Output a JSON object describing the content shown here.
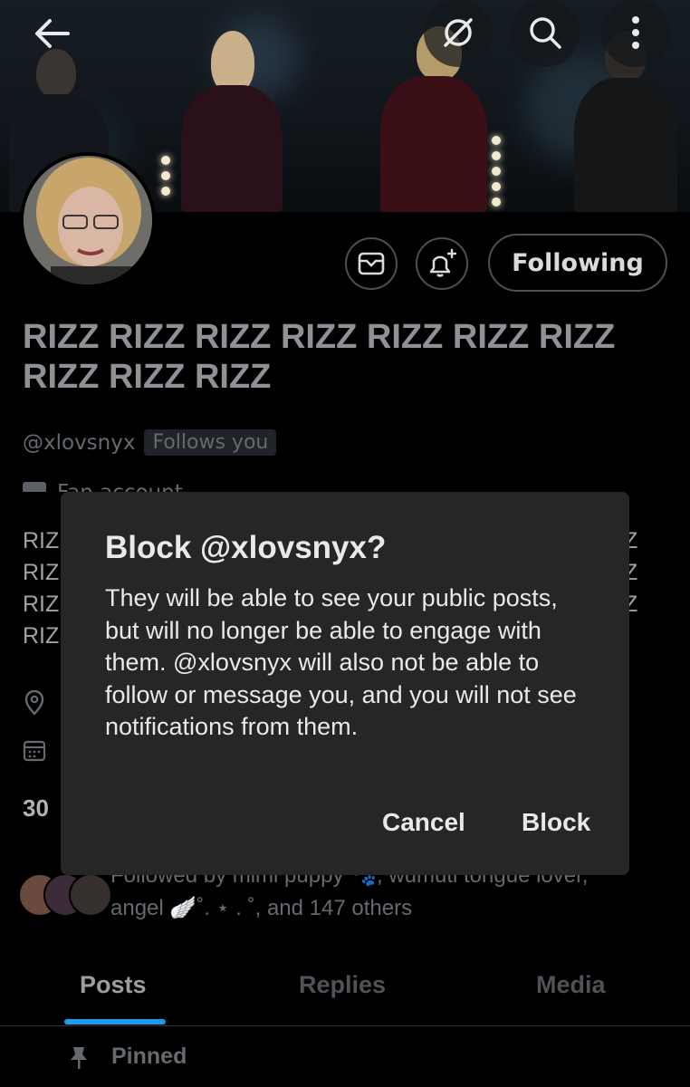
{
  "header": {
    "back_icon": "arrow-left-icon",
    "grok_icon": "slashed-circle-icon",
    "search_icon": "search-icon",
    "more_icon": "more-vertical-icon"
  },
  "profile": {
    "display_name": "RIZZ RIZZ RIZZ RIZZ RIZZ RIZZ RIZZ RIZZ RIZZ RIZZ",
    "handle": "@xlovsnyx",
    "follows_you_label": "Follows you",
    "category_label": "Fan account",
    "bio_left_lines": [
      "RIZ",
      "RIZ",
      "RIZ",
      "RIZ"
    ],
    "bio_right_lines": [
      "Z",
      "Z",
      "Z"
    ],
    "stat_fragment": "30",
    "followed_by_line1": "Followed by mimi puppy 🐾, wumuti tongue lover,",
    "followed_by_line2": "angel 🪽˚. ⋆ . ˚, and 147 others"
  },
  "actions": {
    "message_icon": "envelope-icon",
    "notify_icon": "bell-plus-icon",
    "following_label": "Following"
  },
  "dialog": {
    "title": "Block @xlovsnyx?",
    "body": "They will be able to see your public posts, but will no longer be able to engage with them. @xlovsnyx will also not be able to follow or message you, and you will not see notifications from them.",
    "cancel_label": "Cancel",
    "block_label": "Block"
  },
  "tabs": [
    {
      "label": "Posts",
      "active": true
    },
    {
      "label": "Replies",
      "active": false
    },
    {
      "label": "Media",
      "active": false
    }
  ],
  "pinned_label": "Pinned",
  "colors": {
    "background": "#000000",
    "dialog": "#262626",
    "accent": "#1d9bf0",
    "muted_text": "#646a70"
  }
}
